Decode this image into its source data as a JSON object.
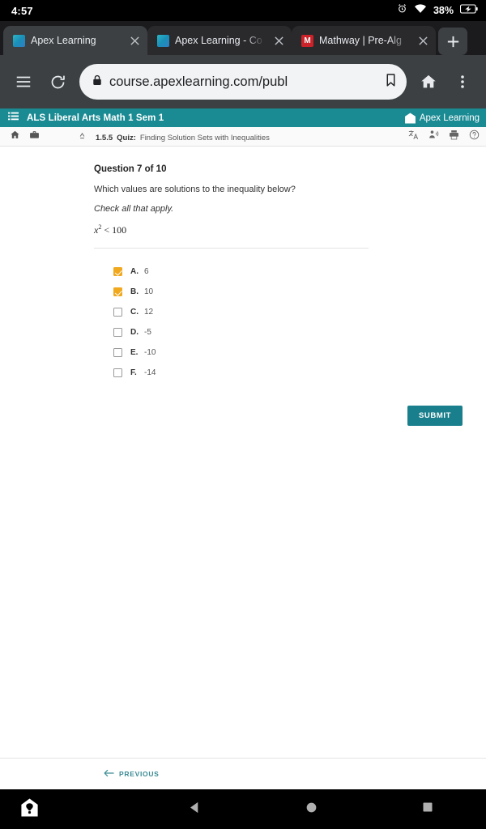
{
  "status_bar": {
    "time": "4:57",
    "battery_percent": "38%",
    "icons": [
      "alarm-icon",
      "wifi-icon",
      "battery-charging-icon"
    ]
  },
  "browser": {
    "tabs": [
      {
        "title": "Apex Learning",
        "favicon": "apex-favicon",
        "active": true
      },
      {
        "title": "Apex Learning - Co",
        "favicon": "apex-favicon",
        "active": false
      },
      {
        "title": "Mathway | Pre-Alg",
        "favicon": "mathway-favicon",
        "active": false
      }
    ],
    "new_tab_label": "+",
    "url": "course.apexlearning.com/publ",
    "toolbar_icons": [
      "menu-icon",
      "reload-icon",
      "lock-icon",
      "bookmark-icon",
      "home-icon",
      "overflow-menu-icon"
    ]
  },
  "als_header": {
    "course_title": "ALS Liberal Arts Math 1 Sem 1",
    "brand_name": "Apex Learning",
    "menu_icon": "list-menu-icon"
  },
  "als_subbar": {
    "left_icons": [
      "home-icon",
      "briefcase-icon",
      "up-arrow-icon"
    ],
    "crumb_number": "1.5.5",
    "crumb_type": "Quiz:",
    "crumb_name": "Finding Solution Sets with Inequalities",
    "right_icons": [
      "translate-icon",
      "read-aloud-icon",
      "print-icon",
      "help-icon"
    ]
  },
  "question": {
    "heading": "Question 7 of 10",
    "prompt": "Which values are solutions to the inequality below?",
    "instruction": "Check all that apply.",
    "math_variable": "x",
    "math_exponent": "2",
    "math_rest": " < 100",
    "options": [
      {
        "letter": "A.",
        "value": "6",
        "checked": true
      },
      {
        "letter": "B.",
        "value": "10",
        "checked": true
      },
      {
        "letter": "C.",
        "value": "12",
        "checked": false
      },
      {
        "letter": "D.",
        "value": "-5",
        "checked": false
      },
      {
        "letter": "E.",
        "value": "-10",
        "checked": false
      },
      {
        "letter": "F.",
        "value": "-14",
        "checked": false
      }
    ],
    "submit_label": "SUBMIT"
  },
  "page_nav": {
    "previous_label": "PREVIOUS"
  },
  "android_nav": {
    "icons": [
      "app-logo-icon",
      "back-icon",
      "home-icon",
      "recents-icon"
    ]
  },
  "colors": {
    "teal_header": "#1a8a93",
    "teal_button": "#1a7f8c",
    "checkbox_orange": "#f0a81e",
    "browser_chrome": "#3c4043"
  }
}
